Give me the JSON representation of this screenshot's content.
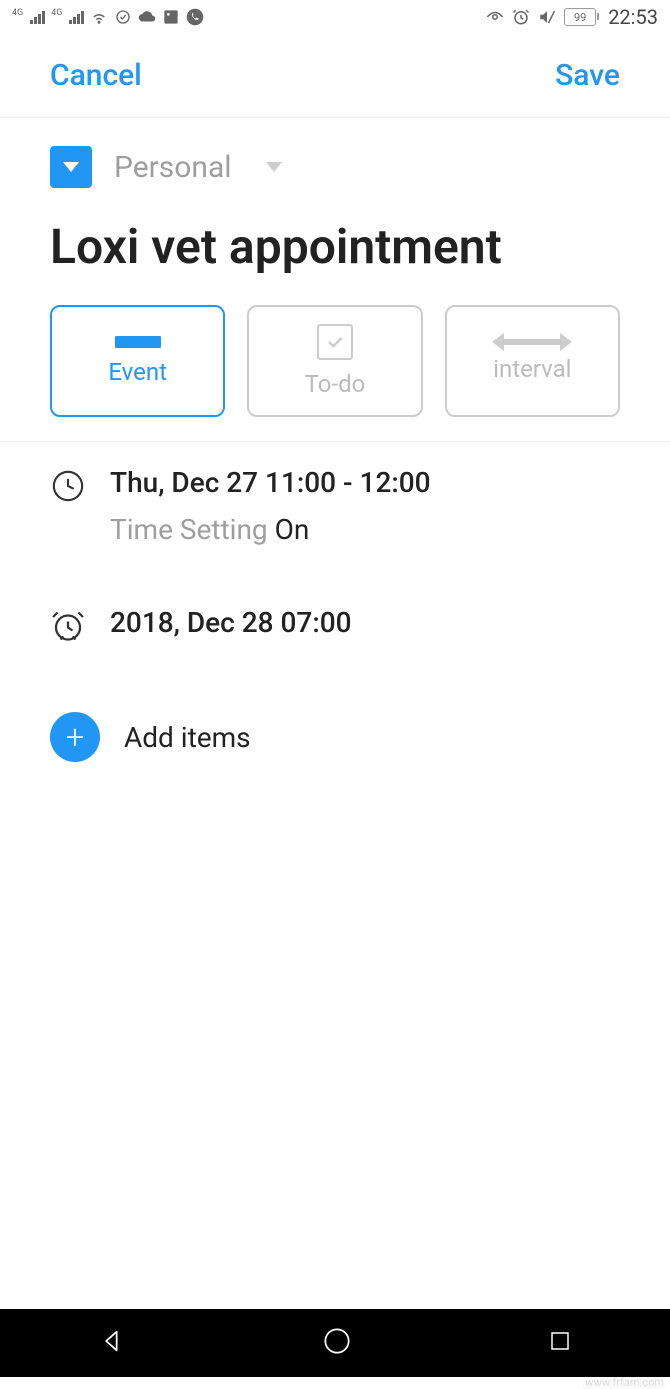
{
  "status": {
    "network_label": "4G",
    "battery": "99",
    "time": "22:53"
  },
  "header": {
    "cancel": "Cancel",
    "save": "Save"
  },
  "category": {
    "label": "Personal"
  },
  "title": "Loxi vet appointment",
  "tabs": {
    "event": "Event",
    "todo": "To-do",
    "interval": "interval"
  },
  "time_row": {
    "value": "Thu, Dec 27 11:00 - 12:00",
    "setting_label": "Time Setting",
    "setting_value": "On"
  },
  "reminder": {
    "value": "2018, Dec 28 07:00"
  },
  "add": {
    "label": "Add items"
  },
  "watermark": "www.frfam.com"
}
